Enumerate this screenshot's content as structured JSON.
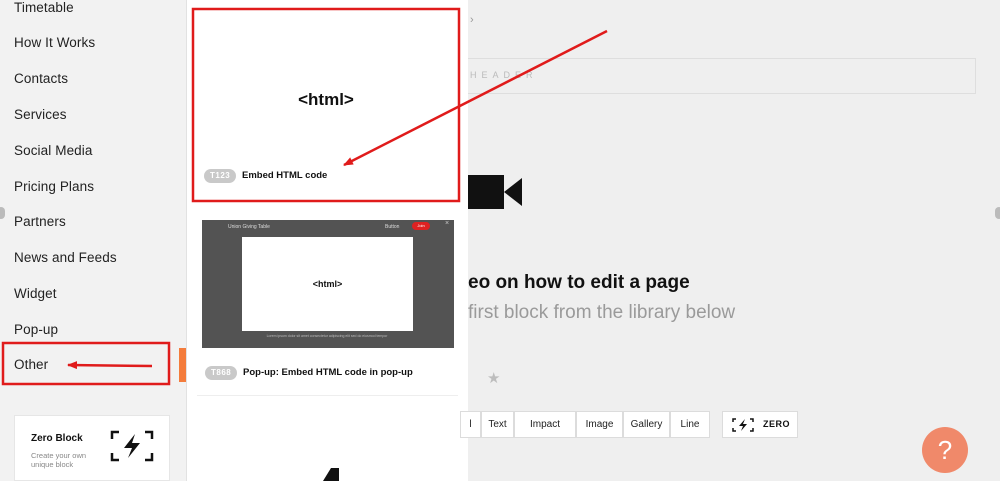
{
  "sidebar": {
    "categories": [
      "Timetable",
      "How It Works",
      "Contacts",
      "Services",
      "Social Media",
      "Pricing Plans",
      "Partners",
      "News and Feeds",
      "Widget",
      "Pop-up",
      "Other"
    ],
    "active_index": 10,
    "zero_block": {
      "title": "Zero Block",
      "description": "Create your own unique block"
    }
  },
  "panel": {
    "cards": [
      {
        "preview_text": "<html>",
        "tag": "T123",
        "label": "Embed HTML code"
      },
      {
        "preview_text": "<html>",
        "tag": "T868",
        "label": "Pop-up: Embed HTML code in pop-up",
        "preview_title": "Union Giving Table",
        "preview_caption": "Lorem ipsum dolor sit amet consectetur adipiscing elit sed do eiusmod tempor"
      }
    ]
  },
  "main": {
    "header_placeholder": "HEADER",
    "chevron": "›",
    "video_text": "eo on how to edit a page",
    "library_text": "first block from the library below",
    "star": "★",
    "type_buttons": [
      "l",
      "Text",
      "Impact",
      "Image",
      "Gallery",
      "Line"
    ],
    "zero_button": "ZERO",
    "help_label": "?"
  },
  "colors": {
    "accent": "#f47c3c",
    "annotation": "#e01b1b",
    "help": "#f0896a"
  }
}
